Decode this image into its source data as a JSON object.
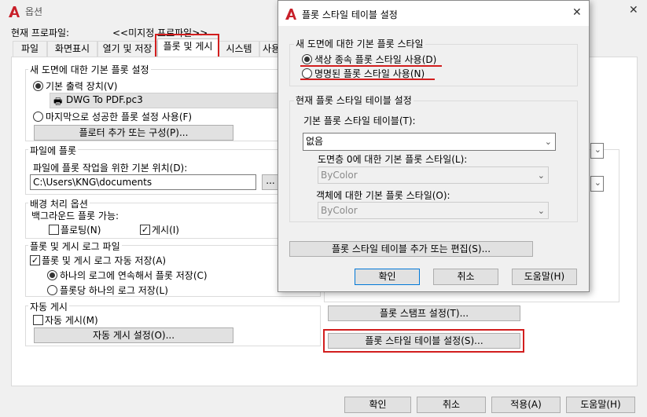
{
  "main_window": {
    "title": "옵션",
    "close_glyph": "✕",
    "profile_label": "현재 프로파일:",
    "profile_value": "<<미지정 프로파일>>",
    "tabs": [
      {
        "label": "파일"
      },
      {
        "label": "화면표시"
      },
      {
        "label": "열기 및 저장"
      },
      {
        "label": "플롯 및 게시"
      },
      {
        "label": "시스템"
      },
      {
        "label": "사용"
      }
    ],
    "new_drawing_plot": {
      "title": "새 도면에 대한 기본 플롯 설정",
      "default_device_label": "기본 출력 장치(V)",
      "device_value": "DWG To PDF.pc3",
      "last_success_label": "마지막으로 성공한 플롯 설정 사용(F)",
      "add_plotter_button": "플로터 추가 또는 구성(P)..."
    },
    "plot_to_file": {
      "title": "파일에 플롯",
      "location_label": "파일에 플롯 작업을 위한 기본 위치(D):",
      "location_value": "C:\\Users\\KNG\\documents",
      "browse_button": "..."
    },
    "background": {
      "title": "배경 처리 옵션",
      "enable_label": "백그라운드 플롯 가능:",
      "plotting_label": "플로팅(N)",
      "publishing_label": "게시(I)"
    },
    "log": {
      "title": "플롯 및 게시 로그 파일",
      "auto_save_label": "플롯 및 게시 로그 자동 저장(A)",
      "continuous_label": "하나의 로그에 연속해서 플롯 저장(C)",
      "per_plot_label": "플롯당 하나의 로그 저장(L)"
    },
    "autopublish": {
      "title": "자동 게시",
      "checkbox_label": "자동 게시(M)",
      "settings_button": "자동 게시 설정(O)..."
    },
    "stamp_button": "플롯 스탬프 설정(T)...",
    "style_table_button": "플롯 스타일 테이블 설정(S)...",
    "footer": {
      "ok": "확인",
      "cancel": "취소",
      "apply": "적용(A)",
      "help": "도움말(H)"
    }
  },
  "dialog": {
    "title": "플롯 스타일 테이블 설정",
    "close_glyph": "✕",
    "default_style_group": "새 도면에 대한 기본 플롯 스타일",
    "color_dependent_label": "색상 종속 플롯 스타일 사용(D)",
    "named_label": "명명된 플롯 스타일 사용(N)",
    "current_table_group": "현재 플롯 스타일 테이블 설정",
    "default_table_label": "기본 플롯 스타일 테이블(T):",
    "default_table_value": "없음",
    "layer0_label": "도면층 0에 대한 기본 플롯 스타일(L):",
    "layer0_value": "ByColor",
    "object_label": "객체에 대한 기본 플롯 스타일(O):",
    "object_value": "ByColor",
    "add_edit_button": "플롯 스타일 테이블 추가 또는 편집(S)...",
    "ok": "확인",
    "cancel": "취소",
    "help": "도움말(H)"
  },
  "colors": {
    "highlight": "#d21e1e",
    "logo": "#c8202a"
  }
}
